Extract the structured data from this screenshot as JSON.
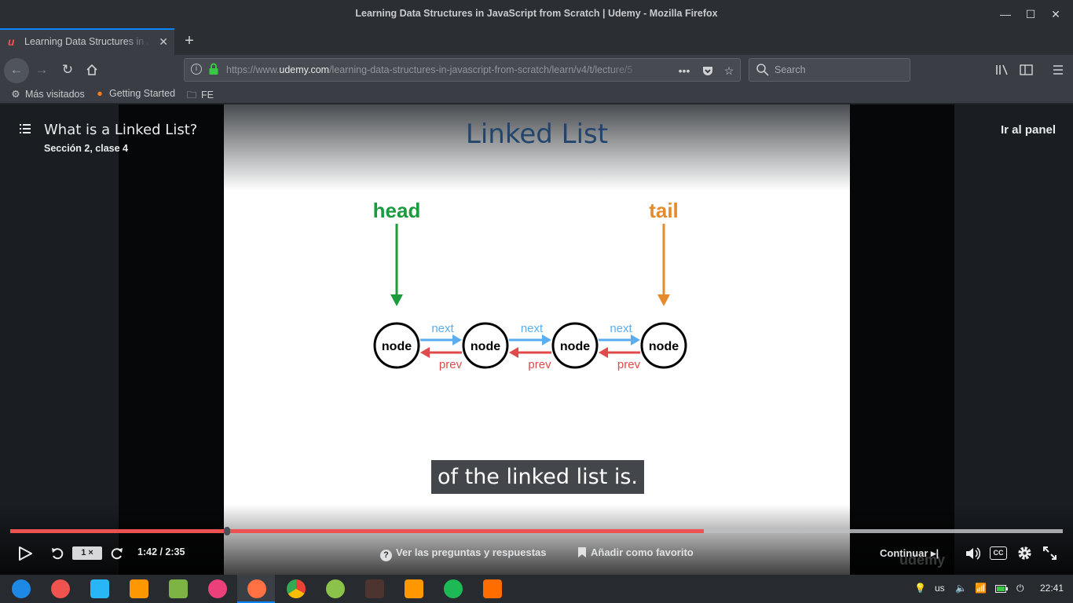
{
  "window": {
    "title": "Learning Data Structures in JavaScript from Scratch | Udemy - Mozilla Firefox"
  },
  "tab": {
    "label": "Learning Data Structures in JavaScript from Scratch"
  },
  "urlbar": {
    "url_prefix": "https://www.",
    "url_domain": "udemy.com",
    "url_path": "/learning-data-structures-in-javascript-from-scratch/learn/v4/t/lecture/5"
  },
  "searchbar": {
    "placeholder": "Search"
  },
  "bookmarks": [
    "Más visitados",
    "Getting Started",
    "FE"
  ],
  "lesson": {
    "title": "What is a Linked List?",
    "subtitle": "Sección 2, clase 4",
    "dashboard_link": "Ir al panel"
  },
  "slide": {
    "title": "Linked List",
    "head_label": "head",
    "tail_label": "tail",
    "node_label": "node",
    "next_label": "next",
    "prev_label": "prev",
    "colors": {
      "head": "#1c9a3e",
      "tail": "#e68a2e",
      "next": "#5aaef0",
      "prev": "#e04a4a"
    }
  },
  "player": {
    "caption": "of the linked list is.",
    "progress_fraction": 0.659,
    "buffered_fraction": 0.892,
    "speed": "1 ×",
    "time": "1:42 / 2:35",
    "qa_label": "Ver las preguntas y respuestas",
    "bookmark_label": "Añadir como favorito",
    "continue_label": "Continuar",
    "cc_label": "CC",
    "watermark": "udemy",
    "accent": "#ec5252"
  },
  "taskbar": {
    "keyboard": "us",
    "clock": "22:41"
  }
}
